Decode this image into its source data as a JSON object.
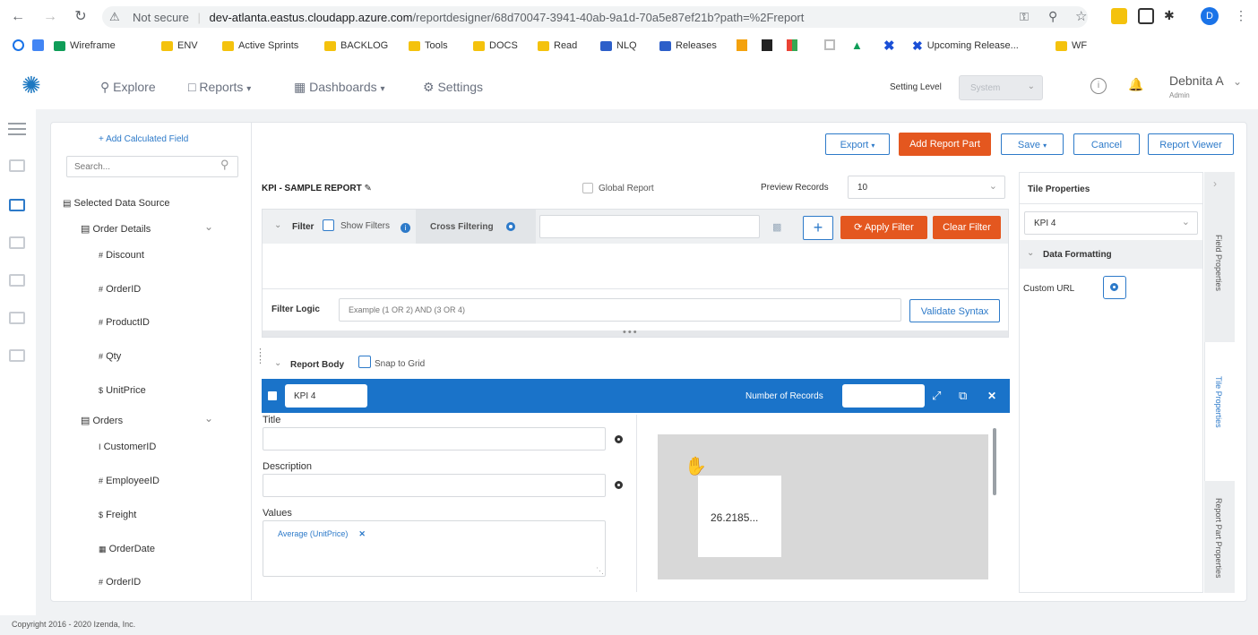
{
  "browser": {
    "security": "Not secure",
    "url_host": "dev-atlanta.eastus.cloudapp.azure.com",
    "url_path": "/reportdesigner/68d70047-3941-40ab-9a1d-70a5e87ef21b?path=%2Freport",
    "profile_initial": "D",
    "bookmarks": [
      "Wireframe",
      "ENV",
      "Active Sprints",
      "BACKLOG",
      "Tools",
      "DOCS",
      "Read",
      "NLQ",
      "Releases",
      "Upcoming Release...",
      "WF"
    ]
  },
  "nav": {
    "explore": "Explore",
    "reports": "Reports",
    "dashboards": "Dashboards",
    "settings": "Settings",
    "setting_level_label": "Setting Level",
    "setting_level_value": "System",
    "user_name": "Debnita A",
    "user_role": "Admin"
  },
  "fields": {
    "add_calculated": "+ Add Calculated Field",
    "search_placeholder": "Search...",
    "selected_source": "Selected Data Source",
    "group1": "Order Details",
    "group1_items": [
      "Discount",
      "OrderID",
      "ProductID",
      "Qty",
      "UnitPrice"
    ],
    "group2": "Orders",
    "group2_items": [
      "CustomerID",
      "EmployeeID",
      "Freight",
      "OrderDate",
      "OrderID"
    ]
  },
  "toolbar": {
    "export": "Export",
    "add_report_part": "Add Report Part",
    "save": "Save",
    "cancel": "Cancel",
    "report_viewer": "Report Viewer"
  },
  "report": {
    "name": "KPI - SAMPLE REPORT",
    "global_report": "Global Report",
    "preview_label": "Preview Records",
    "preview_value": "10"
  },
  "filter": {
    "label": "Filter",
    "show_filters": "Show Filters",
    "cross_filtering": "Cross Filtering",
    "apply": "Apply Filter",
    "clear": "Clear Filter",
    "logic_label": "Filter Logic",
    "logic_placeholder": "Example (1 OR 2) AND (3 OR 4)",
    "validate": "Validate Syntax"
  },
  "body": {
    "label": "Report Body",
    "snap": "Snap to Grid",
    "part_name": "KPI 4",
    "records_label": "Number of Records",
    "title_label": "Title",
    "desc_label": "Description",
    "values_label": "Values",
    "value_chip": "Average (UnitPrice)",
    "kpi_value": "26.2185..."
  },
  "props": {
    "title": "Tile Properties",
    "tile_select": "KPI 4",
    "data_formatting": "Data Formatting",
    "custom_url": "Custom URL",
    "tab_field": "Field Properties",
    "tab_tile": "Tile Properties",
    "tab_report_part": "Report Part Properties"
  },
  "footer": "Copyright 2016 - 2020 Izenda, Inc.",
  "colors": {
    "accent": "#2d7ac9",
    "orange": "#e4571f",
    "blue_bar": "#1a73c9"
  }
}
